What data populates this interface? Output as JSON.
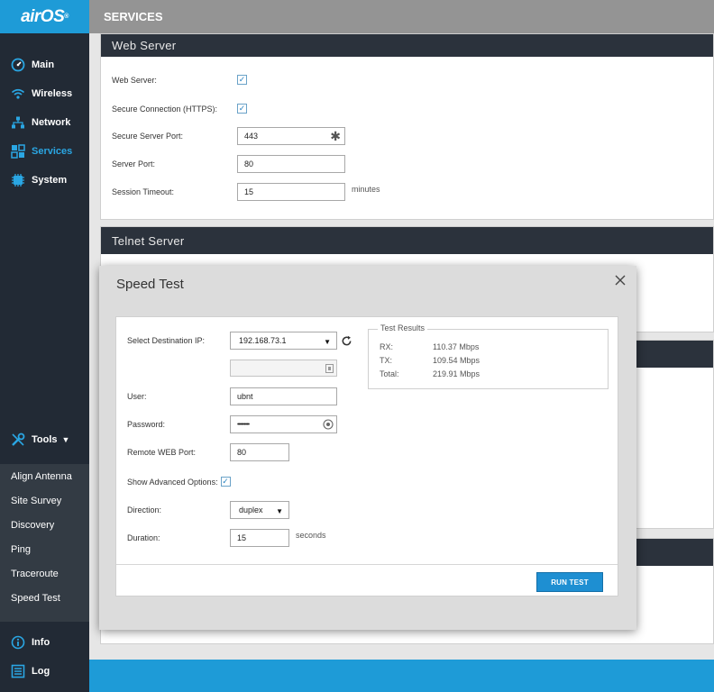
{
  "brand": {
    "logo_text": "airOS",
    "logo_mark": "®"
  },
  "header": {
    "title": "SERVICES"
  },
  "sidebar": {
    "items": [
      {
        "label": "Main",
        "icon": "gauge-icon"
      },
      {
        "label": "Wireless",
        "icon": "wifi-icon"
      },
      {
        "label": "Network",
        "icon": "network-icon"
      },
      {
        "label": "Services",
        "icon": "services-icon",
        "active": true
      },
      {
        "label": "System",
        "icon": "system-icon"
      }
    ],
    "tools_label": "Tools",
    "tools_items": [
      "Align Antenna",
      "Site Survey",
      "Discovery",
      "Ping",
      "Traceroute",
      "Speed Test"
    ],
    "bottom_items": [
      {
        "label": "Info",
        "icon": "info-icon"
      },
      {
        "label": "Log",
        "icon": "log-icon"
      }
    ]
  },
  "web_server": {
    "title": "Web Server",
    "web_server_label": "Web Server:",
    "web_server_checked": true,
    "https_label": "Secure Connection (HTTPS):",
    "https_checked": true,
    "secure_port_label": "Secure Server Port:",
    "secure_port_value": "443",
    "server_port_label": "Server Port:",
    "server_port_value": "80",
    "session_timeout_label": "Session Timeout:",
    "session_timeout_value": "15",
    "session_timeout_unit": "minutes"
  },
  "telnet_server": {
    "title": "Telnet Server"
  },
  "speed_test": {
    "title": "Speed Test",
    "dest_ip_label": "Select Destination IP:",
    "dest_ip_value": "192.168.73.1",
    "custom_ip_value": "",
    "user_label": "User:",
    "user_value": "ubnt",
    "password_label": "Password:",
    "password_value": "•••••••••",
    "remote_port_label": "Remote WEB Port:",
    "remote_port_value": "80",
    "advanced_label": "Show Advanced Options:",
    "advanced_checked": true,
    "direction_label": "Direction:",
    "direction_value": "duplex",
    "duration_label": "Duration:",
    "duration_value": "15",
    "duration_unit": "seconds",
    "results": {
      "legend": "Test Results",
      "rx_label": "RX:",
      "rx_value": "110.37 Mbps",
      "tx_label": "TX:",
      "tx_value": "109.54 Mbps",
      "total_label": "Total:",
      "total_value": "219.91 Mbps"
    },
    "run_button": "RUN TEST"
  },
  "colors": {
    "accent": "#1e9bd7",
    "sidebar": "#222a35",
    "panel_header": "#2b323c",
    "active_nav": "#2aa6e3"
  }
}
